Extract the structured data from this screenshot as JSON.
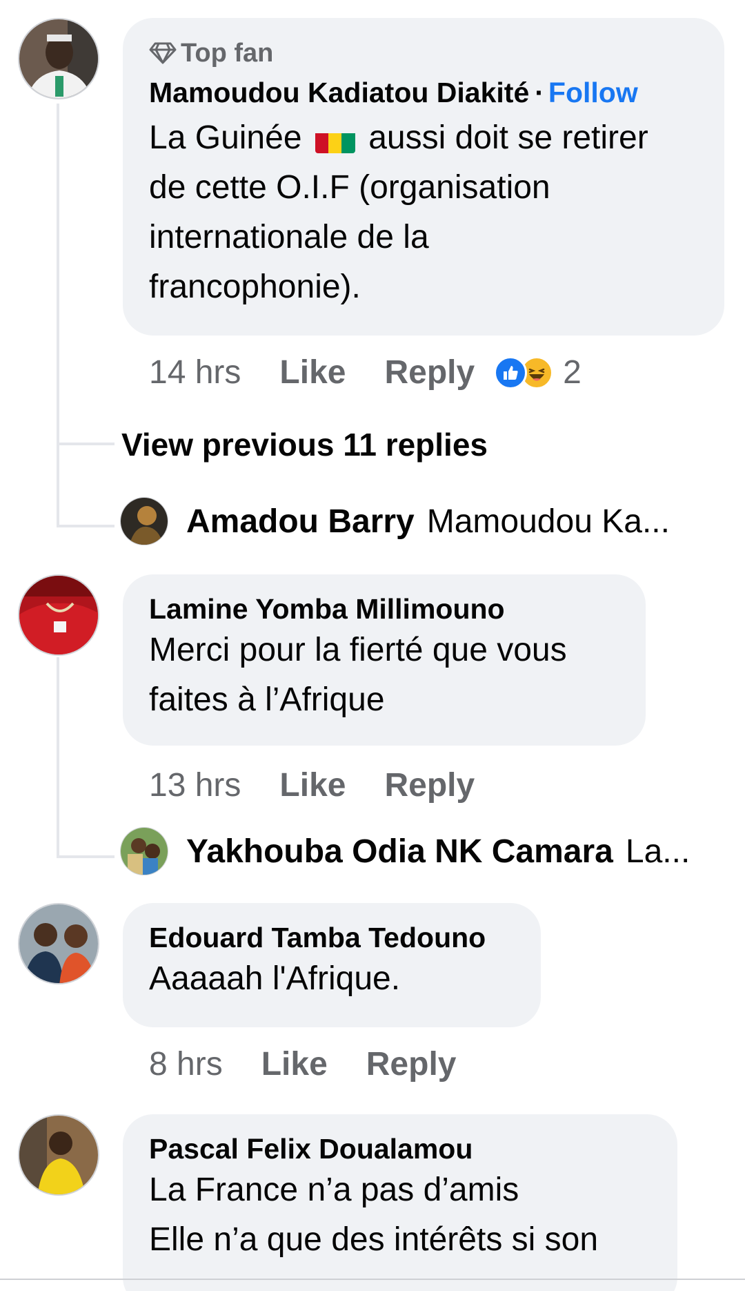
{
  "comments": [
    {
      "badge": "Top fan",
      "author": "Mamoudou Kadiatou Diakité",
      "follow_separator": "·",
      "follow_label": "Follow",
      "text_line1_a": "La Guinée",
      "text_line1_b": "aussi doit se retirer",
      "text_line2": "de cette O.I.F (organisation",
      "text_line3": "internationale de la",
      "text_line4": "francophonie).",
      "time": "14 hrs",
      "like_label": "Like",
      "reply_label": "Reply",
      "reaction_count": "2",
      "view_previous": "View previous 11 replies",
      "reply_preview": {
        "author": "Amadou Barry",
        "text": "Mamoudou Ka..."
      }
    },
    {
      "author": "Lamine Yomba Millimouno",
      "text_line1": "Merci pour la fierté que vous",
      "text_line2": "faites à l’Afrique",
      "time": "13 hrs",
      "like_label": "Like",
      "reply_label": "Reply",
      "reply_preview": {
        "author": "Yakhouba Odia NK Camara",
        "text": "La..."
      }
    },
    {
      "author": "Edouard Tamba Tedouno",
      "text_line1": "Aaaaah l'Afrique.",
      "time": "8 hrs",
      "like_label": "Like",
      "reply_label": "Reply"
    },
    {
      "author": "Pascal Felix Doualamou",
      "text_line1": "La France n’a pas d’amis",
      "text_line2": "Elle n’a que des intérêts si son"
    }
  ],
  "colors": {
    "bubble_bg": "#f0f2f5",
    "link_blue": "#1877f2",
    "meta_gray": "#65676b",
    "thread_line": "#e4e6eb"
  },
  "icons": {
    "badge": "diamond-icon",
    "reactions": [
      "like-reaction-icon",
      "haha-reaction-icon"
    ],
    "flag": "guinea-flag-icon"
  }
}
